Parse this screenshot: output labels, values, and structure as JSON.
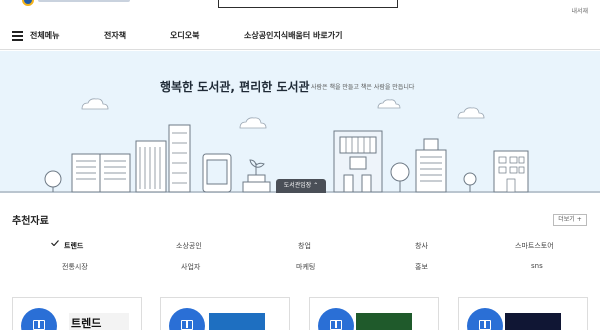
{
  "header": {
    "mini_link": "내서재"
  },
  "gnb": {
    "menu_all": "전체메뉴",
    "items": [
      "전자책",
      "오디오북",
      "소상공인지식배움터 바로가기"
    ]
  },
  "hero": {
    "title": "행복한 도서관, 편리한 도서관",
    "subtitle": "사람은 책을 만들고 책은 사람을 만듭니다",
    "ebook_button": "도서관입장"
  },
  "recommend": {
    "title": "추천자료",
    "more": "더보기 +",
    "categories_row1": [
      "트렌드",
      "소상공인",
      "창업",
      "창사",
      "스마트스토어"
    ],
    "categories_row2": [
      "전통시장",
      "사업자",
      "마케팅",
      "홍보",
      "sns"
    ],
    "active": "트렌드"
  },
  "cards": [
    {
      "cover_text": "트렌드",
      "cover_color": "#1d1d1d"
    },
    {
      "cover_text": "",
      "cover_color": "#1e6fc1"
    },
    {
      "cover_text": "",
      "cover_color": "#1f5a2b"
    },
    {
      "cover_text": "",
      "cover_color": "#101634"
    }
  ],
  "colors": {
    "accent": "#2a6fd6",
    "hero_bg": "#e9f4fc"
  }
}
